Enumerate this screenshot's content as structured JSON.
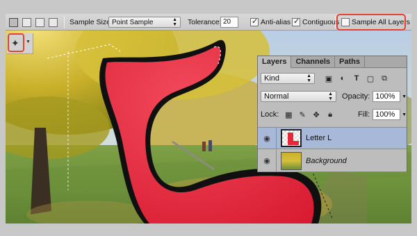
{
  "colors": {
    "highlight": "#e6422e",
    "letter_fill": "#e8283a",
    "selected_layer": "#a8b8d8"
  },
  "options_bar": {
    "sample_size_label": "Sample Size:",
    "sample_size_value": "Point Sample",
    "tolerance_label": "Tolerance:",
    "tolerance_value": "20",
    "anti_alias_label": "Anti-alias",
    "anti_alias_checked": true,
    "contiguous_label": "Contiguous",
    "contiguous_checked": true,
    "sample_all_layers_label": "Sample All Layers",
    "sample_all_layers_checked": false
  },
  "layers_panel": {
    "tabs": [
      "Layers",
      "Channels",
      "Paths"
    ],
    "active_tab": "Layers",
    "filter_kind": "Kind",
    "blend_mode": "Normal",
    "opacity_label": "Opacity:",
    "opacity_value": "100%",
    "lock_label": "Lock:",
    "fill_label": "Fill:",
    "fill_value": "100%",
    "layers": [
      {
        "name": "Letter L",
        "selected": true,
        "italic": false
      },
      {
        "name": "Background",
        "selected": false,
        "italic": true
      }
    ]
  }
}
